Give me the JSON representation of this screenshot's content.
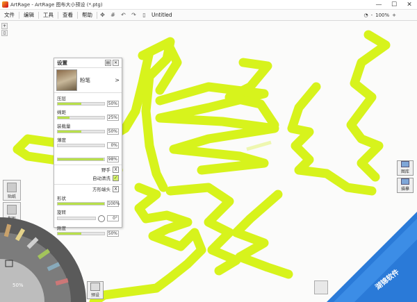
{
  "window": {
    "title": "ArtRage - ArtRage 图布大小预设 (*.ptg)",
    "min": "—",
    "max": "☐",
    "close": "✕"
  },
  "menu": [
    "文件",
    "编辑",
    "工具",
    "查看",
    "帮助"
  ],
  "toolbar": {
    "doc_name": "Untitled",
    "zoom": "100%",
    "zoom_minus": "-",
    "zoom_plus": "+"
  },
  "settings": {
    "title": "设置",
    "tool_name": "粉笔",
    "more": ">",
    "sliders": [
      {
        "label": "压层",
        "value": "50%",
        "level": 0.5
      },
      {
        "label": "绵距",
        "value": "25%",
        "level": 0.25
      },
      {
        "label": "装载量",
        "value": "50%",
        "level": 0.5
      },
      {
        "label": "薄度",
        "value": "0%",
        "level": 0.0
      },
      {
        "label": "",
        "value": "98%",
        "level": 0.98
      }
    ],
    "freehand_label": "野手",
    "freehand_state": "X",
    "auto_clean_label": "自动清洗",
    "auto_clean_state": "✓",
    "square_tip_label": "方形端头",
    "square_tip_state": "X",
    "shape_label": "形状",
    "shape_value": "100%",
    "rotation_label": "旋转",
    "rotation_value": "0°",
    "hardness_label": "刚度",
    "hardness_value": "50%"
  },
  "left_buttons": [
    {
      "label": "贴纸",
      "icon": "sticker-icon"
    },
    {
      "label": "型板",
      "icon": "stencil-icon"
    }
  ],
  "picker": {
    "zoom": "50%"
  },
  "preset_button": {
    "label": "预设"
  },
  "right_buttons": [
    {
      "label": "图库",
      "icon": "image-icon"
    },
    {
      "label": "描摹",
      "icon": "trace-icon"
    }
  ],
  "watermark": {
    "text": "湖锦软件"
  },
  "colors": {
    "stroke": "#d7f31c",
    "accent": "#b8e04a",
    "watermark_blue": "#2a7ad8"
  }
}
